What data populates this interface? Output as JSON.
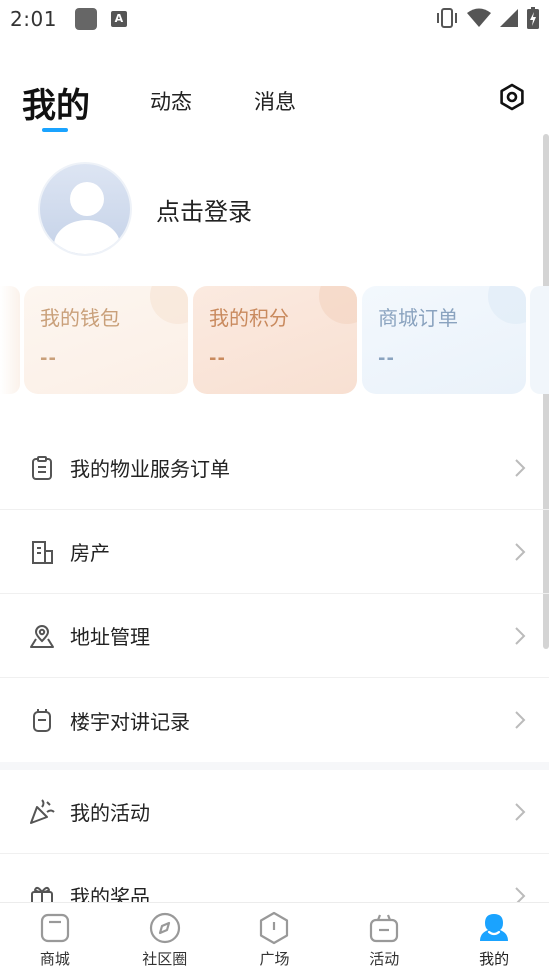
{
  "status_bar": {
    "time": "2:01"
  },
  "top_tabs": {
    "mine": "我的",
    "feed": "动态",
    "messages": "消息"
  },
  "profile": {
    "login_prompt": "点击登录"
  },
  "cards": [
    {
      "label": "我的钱包",
      "value": "--",
      "color": "#c9a07a"
    },
    {
      "label": "我的积分",
      "value": "--",
      "color": "#c98a5e"
    },
    {
      "label": "商城订单",
      "value": "--",
      "color": "#8aa3bf"
    }
  ],
  "menu": [
    {
      "label": "我的物业服务订单",
      "icon": "clipboard-icon"
    },
    {
      "label": "房产",
      "icon": "building-icon"
    },
    {
      "label": "地址管理",
      "icon": "location-icon"
    },
    {
      "label": "楼宇对讲记录",
      "icon": "intercom-icon"
    },
    {
      "label": "我的活动",
      "icon": "party-popper-icon"
    },
    {
      "label": "我的奖品",
      "icon": "gift-icon"
    }
  ],
  "bottom_nav": [
    {
      "label": "商城",
      "icon": "shop-icon"
    },
    {
      "label": "社区圈",
      "icon": "compass-icon"
    },
    {
      "label": "广场",
      "icon": "square-icon"
    },
    {
      "label": "活动",
      "icon": "activity-icon"
    },
    {
      "label": "我的",
      "icon": "profile-icon",
      "active": true
    }
  ],
  "colors": {
    "accent": "#1aa3ff"
  }
}
